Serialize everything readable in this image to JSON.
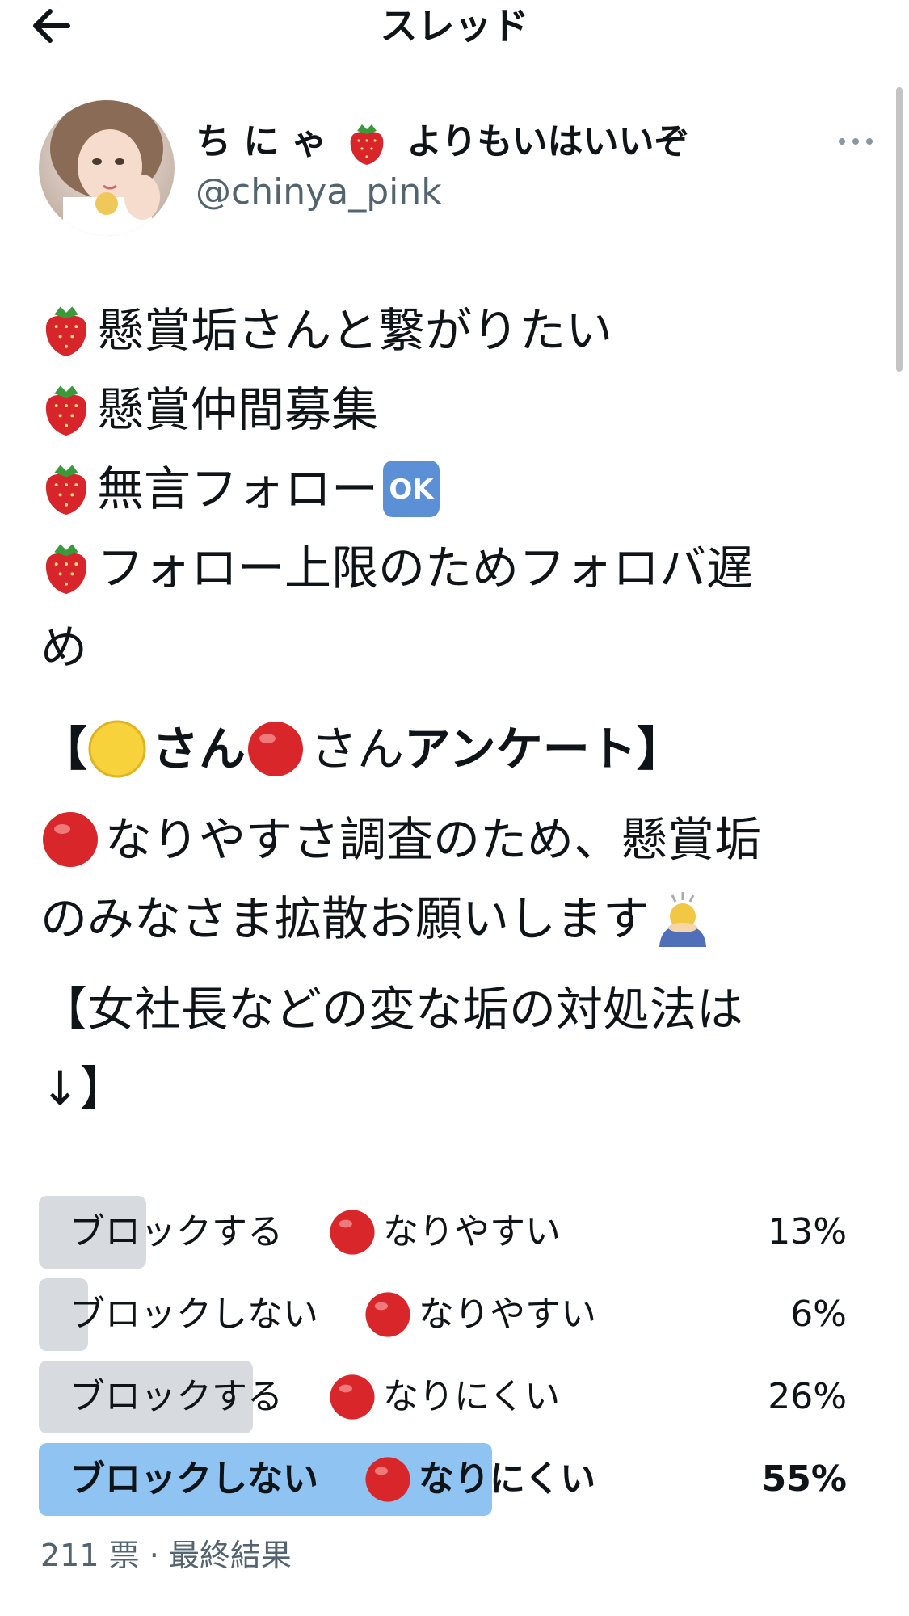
{
  "header": {
    "title": "スレッド"
  },
  "author": {
    "name_prefix": "ち に ゃ",
    "name_suffix": "よりもいはいいぞ",
    "handle": "@chinya_pink"
  },
  "tweet": {
    "line1": "懸賞垢さんと繋がりたい",
    "line2": "懸賞仲間募集",
    "line3": "無言フォロー",
    "ok_badge": "OK",
    "line4a": "フォロー上限のためフォロバ遅",
    "line4b": "め",
    "survey_open": "【",
    "survey_san1": "さん",
    "survey_san2": "さん",
    "survey_title": "アンケート",
    "survey_close": "】",
    "desc1": "なりやすさ調査のため、懸賞垢",
    "desc2": "のみなさま拡散お願いします",
    "note1": "【女社長などの変な垢の対処法は",
    "note2": "↓】"
  },
  "poll": {
    "options": [
      {
        "left": "ブロックする",
        "right": "なりやすい",
        "percent": "13%",
        "value": 13
      },
      {
        "left": "ブロックしない",
        "right": "なりやすい",
        "percent": "6%",
        "value": 6
      },
      {
        "left": "ブロックする",
        "right": "なりにくい",
        "percent": "26%",
        "value": 26
      },
      {
        "left": "ブロックしない",
        "right": "なりにくい",
        "percent": "55%",
        "value": 55
      }
    ],
    "votes": "211 票",
    "separator": "·",
    "status": "最終結果"
  },
  "colors": {
    "poll_fill": "#d7dbdf",
    "poll_winner": "#8ec3f2",
    "red_dot": "#d9262a",
    "yellow_dot": "#f7d23a"
  }
}
